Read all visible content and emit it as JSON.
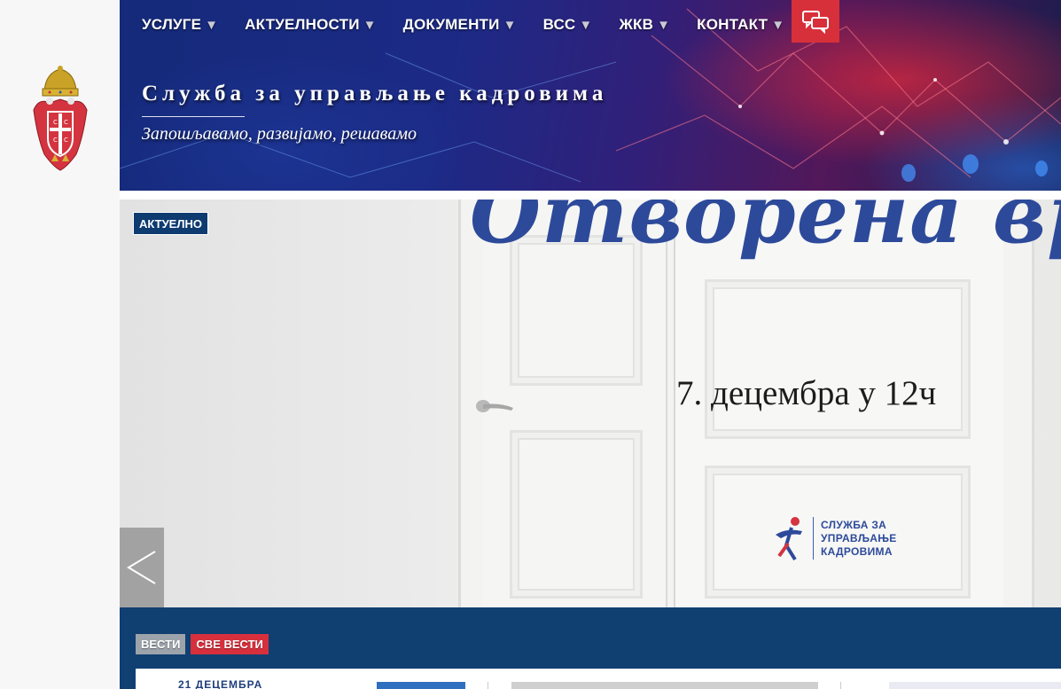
{
  "sidebar": {
    "coat_of_arms": "serbia-coat-of-arms-icon"
  },
  "nav": {
    "items": [
      {
        "label": "УСЛУГЕ",
        "caret": "▼"
      },
      {
        "label": "АКТУЕЛНОСТИ",
        "caret": "▼"
      },
      {
        "label": "ДОКУМЕНТИ",
        "caret": "▼"
      },
      {
        "label": "ВСС",
        "caret": "▼"
      },
      {
        "label": "ЖКВ",
        "caret": "▼"
      },
      {
        "label": "КОНТАКТ",
        "caret": "▼"
      }
    ],
    "chat_icon": "chat-bubbles-icon"
  },
  "header": {
    "title": "Служба за управљање кадровима",
    "tagline": "Запошљавамо, развијамо, решавамо"
  },
  "slider": {
    "badge": "АКТУЕЛНО",
    "headline": "Отворена врата",
    "date_text": "7. децембра у 12ч",
    "logo_lines": [
      "СЛУЖБА ЗА",
      "УПРАВЉАЊЕ",
      "КАДРОВИМА"
    ],
    "prev_label": "<"
  },
  "news": {
    "tab_news": "ВЕСТИ",
    "tab_all": "СВЕ ВЕСТИ",
    "card1_text": "21 ДЕЦЕМБРА"
  },
  "colors": {
    "chat_button": "#d8303a",
    "badge_bg": "#0e3b70",
    "news_bg": "#103f72",
    "tab_all": "#d7303c",
    "tab_news": "#9ca3aa"
  }
}
